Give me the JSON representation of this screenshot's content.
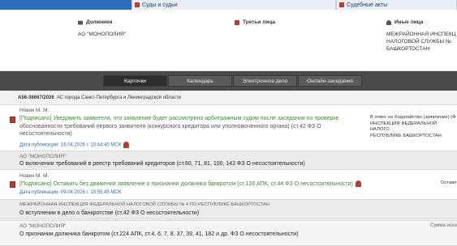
{
  "top_tabs": {
    "courts": "Суды и судьи",
    "acts": "Судебные акты"
  },
  "parties": {
    "debtors": {
      "label": "Должники",
      "value": "АО \"МОНОПОЛИЯ\""
    },
    "third": {
      "label": "Третьи лица",
      "value": ""
    },
    "others": {
      "label": "Иные лица",
      "value_line1": "МЕЖРАЙОННАЯ ИНСПЕКЦ",
      "value_line2": "НАЛОГОВОЙ СЛУЖБЫ №",
      "value_line3": "БАШКОРТОСТАН"
    }
  },
  "nav": {
    "cards": "Карточки",
    "calendar": "Календарь",
    "edelo": "Электронное дело",
    "online": "Онлайн-заседания"
  },
  "case": {
    "number": "А56-36667/2026",
    "court": "АС города Санкт-Петербурга и Ленинградской области"
  },
  "entries": [
    {
      "judge": "Новик М. М.",
      "status": "[Подписано]",
      "text_line1": "Уведомить заявителя, что заявление будет рассмотрено арбитражным судом после заседания по проверке",
      "text_line2": "обоснованности требований первого заявителя (конкурсного кредитора или уполномоченного органа) (ст.42 ФЗ О",
      "text_line3": "несостоятельности)",
      "published": "Дата публикации: 16.04.2026 г. 13:44:40 МСК",
      "side_line1": "В ответ на Ходатайство (заявление) (Ф",
      "side_line2": "ИНСПЕКЦИЯ ФЕДЕРАЛЬНОЙ НАЛОГО",
      "side_line3": "РЕСПУБЛИКЕ БАШКОРТОСТАН"
    },
    {
      "judge": "Новик М. М.",
      "status": "[Подписано]",
      "text_line1": "Оставить без движения заявление о признании должника банкротом (ст.128 АПК, ст.44 ФЗ О несостоятельности)",
      "published": "Дата публикации: 09.04.2026 г. 13:55:45 МСК",
      "side_line1": "Оставл"
    }
  ],
  "grey_rows": [
    {
      "title": "АО \"МОНОПОЛИЯ\"",
      "main": "О включении требований в реестр требований кредиторов (ст.60, 71, 81, 100, 142 ФЗ О несостоятельности)",
      "right": ""
    },
    {
      "title": "МЕЖРАЙОННАЯ ИНСПЕКЦИЯ ФЕДЕРАЛЬНОЙ НАЛОГОВОЙ СЛУЖБЫ № 4 ПО РЕСПУБЛИКЕ БАШКОРТОСТАН",
      "main": "О вступлении в дело о банкротстве (ст.42 ФЗ О несостоятельности)",
      "right": ""
    },
    {
      "title": "АО \"МОНОПОЛИЯ\"",
      "main": "О признании должника банкротом (ст.224 АПК, ст.4, 6, 7, 8, 37, 39, 41, 182 и др. ФЗ О несостоятельности)",
      "right": "Сумма иско"
    }
  ]
}
